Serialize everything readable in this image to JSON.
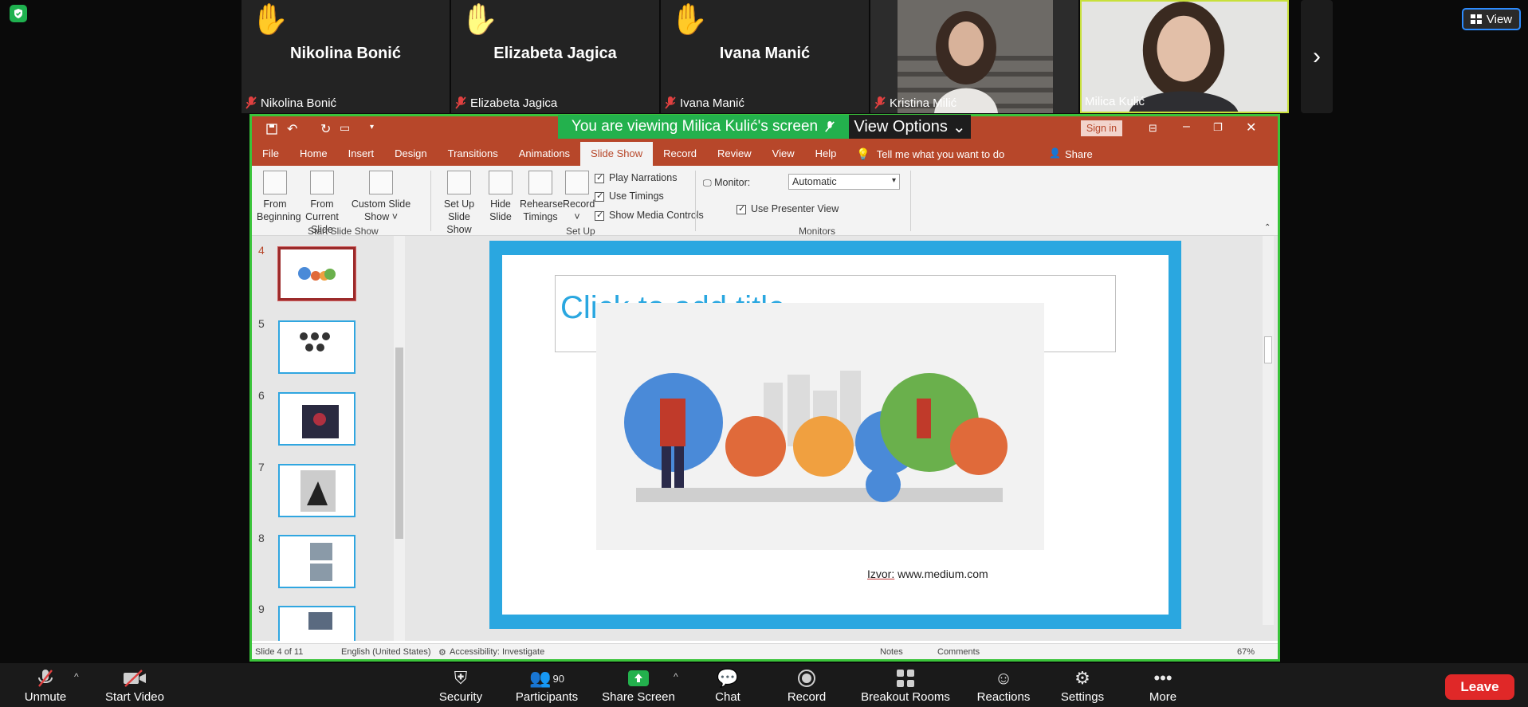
{
  "participants": [
    {
      "big_name": "Nikolina Bonić",
      "name": "Nikolina Bonić",
      "hand": "✋"
    },
    {
      "big_name": "Elizabeta Jagica",
      "name": "Elizabeta Jagica",
      "hand": "✋"
    },
    {
      "big_name": "Ivana Manić",
      "name": "Ivana Manić",
      "hand": "✋"
    },
    {
      "name": "Kristina Milić"
    },
    {
      "name": "Milica Kulić"
    }
  ],
  "view_button": "View",
  "banner": {
    "text": "You are viewing Milica Kulić's screen",
    "view_options": "View Options"
  },
  "ppt": {
    "sign_in": "Sign in",
    "tabs": [
      "File",
      "Home",
      "Insert",
      "Design",
      "Transitions",
      "Animations",
      "Slide Show",
      "Record",
      "Review",
      "View",
      "Help"
    ],
    "active_tab": "Slide Show",
    "tell_me": "Tell me what you want to do",
    "share": "Share",
    "ribbon": {
      "from_beginning": "From Beginning",
      "from_current": "From Current Slide",
      "custom_show": "Custom Slide Show ˅",
      "group_start": "Start Slide Show",
      "setup_show": "Set Up Slide Show",
      "hide_slide": "Hide Slide",
      "rehearse": "Rehearse Timings",
      "record": "Record ˅",
      "play_narrations": "Play Narrations",
      "use_timings": "Use Timings",
      "show_media": "Show Media Controls",
      "group_setup": "Set Up",
      "monitor_label": "Monitor:",
      "monitor_value": "Automatic",
      "presenter_view": "Use Presenter View",
      "group_monitors": "Monitors"
    },
    "thumb_numbers": [
      "4",
      "5",
      "6",
      "7",
      "8",
      "9"
    ],
    "slide": {
      "title_placeholder": "Click to add title",
      "source_prefix": "Izvor:",
      "source_url": "www.medium.com"
    },
    "status": {
      "slide_of": "Slide 4 of 11",
      "language": "English (United States)",
      "accessibility": "Accessibility: Investigate",
      "notes": "Notes",
      "comments": "Comments",
      "zoom": "67%"
    }
  },
  "toolbar": {
    "unmute": "Unmute",
    "start_video": "Start Video",
    "security": "Security",
    "participants": "Participants",
    "participants_count": "90",
    "share_screen": "Share Screen",
    "chat": "Chat",
    "record": "Record",
    "breakout": "Breakout Rooms",
    "reactions": "Reactions",
    "settings": "Settings",
    "more": "More",
    "leave": "Leave"
  },
  "colors": {
    "ppt_accent": "#b7472a",
    "zoom_green": "#23b14d",
    "slide_border": "#2aa7e0",
    "leave": "#e02828"
  }
}
